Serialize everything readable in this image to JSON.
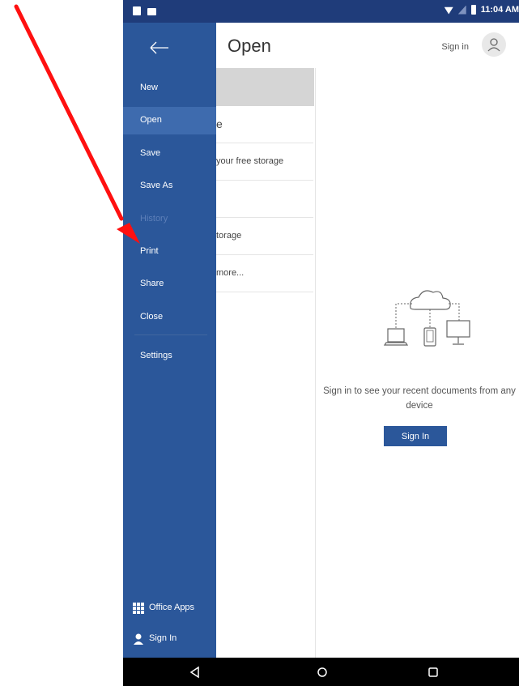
{
  "status_bar": {
    "time": "11:04 AM"
  },
  "header": {
    "title": "Open",
    "signin_label": "Sign in"
  },
  "nav": {
    "items": [
      {
        "label": "New"
      },
      {
        "label": "Open"
      },
      {
        "label": "Save"
      },
      {
        "label": "Save As"
      },
      {
        "label": "History"
      },
      {
        "label": "Print"
      },
      {
        "label": "Share"
      },
      {
        "label": "Close"
      },
      {
        "label": "Settings"
      }
    ],
    "active_item": "Open",
    "disabled_item": "History",
    "bottom": {
      "office_apps": "Office Apps",
      "sign_in": "Sign In"
    }
  },
  "places": {
    "items": [
      {
        "text": ""
      },
      {
        "text": "e"
      },
      {
        "text": "your free storage"
      },
      {
        "text": ""
      },
      {
        "text": "torage"
      },
      {
        "text": "more..."
      }
    ]
  },
  "main": {
    "empty_message": "Sign in to see your recent documents from any device",
    "signin_button": "Sign In"
  },
  "colors": {
    "nav_bg": "#2b579a",
    "status_bar_bg": "#1f3c7a",
    "active_bg": "#3e6bae",
    "annotation_arrow": "#ff0000"
  },
  "icons": {
    "back": "arrow-left-icon",
    "account": "person-icon",
    "office_apps": "grid-icon",
    "sign_in": "person-icon",
    "illustration": "cloud-devices-icon",
    "system_nav": [
      "back-triangle-icon",
      "home-circle-icon",
      "recents-square-icon"
    ]
  }
}
